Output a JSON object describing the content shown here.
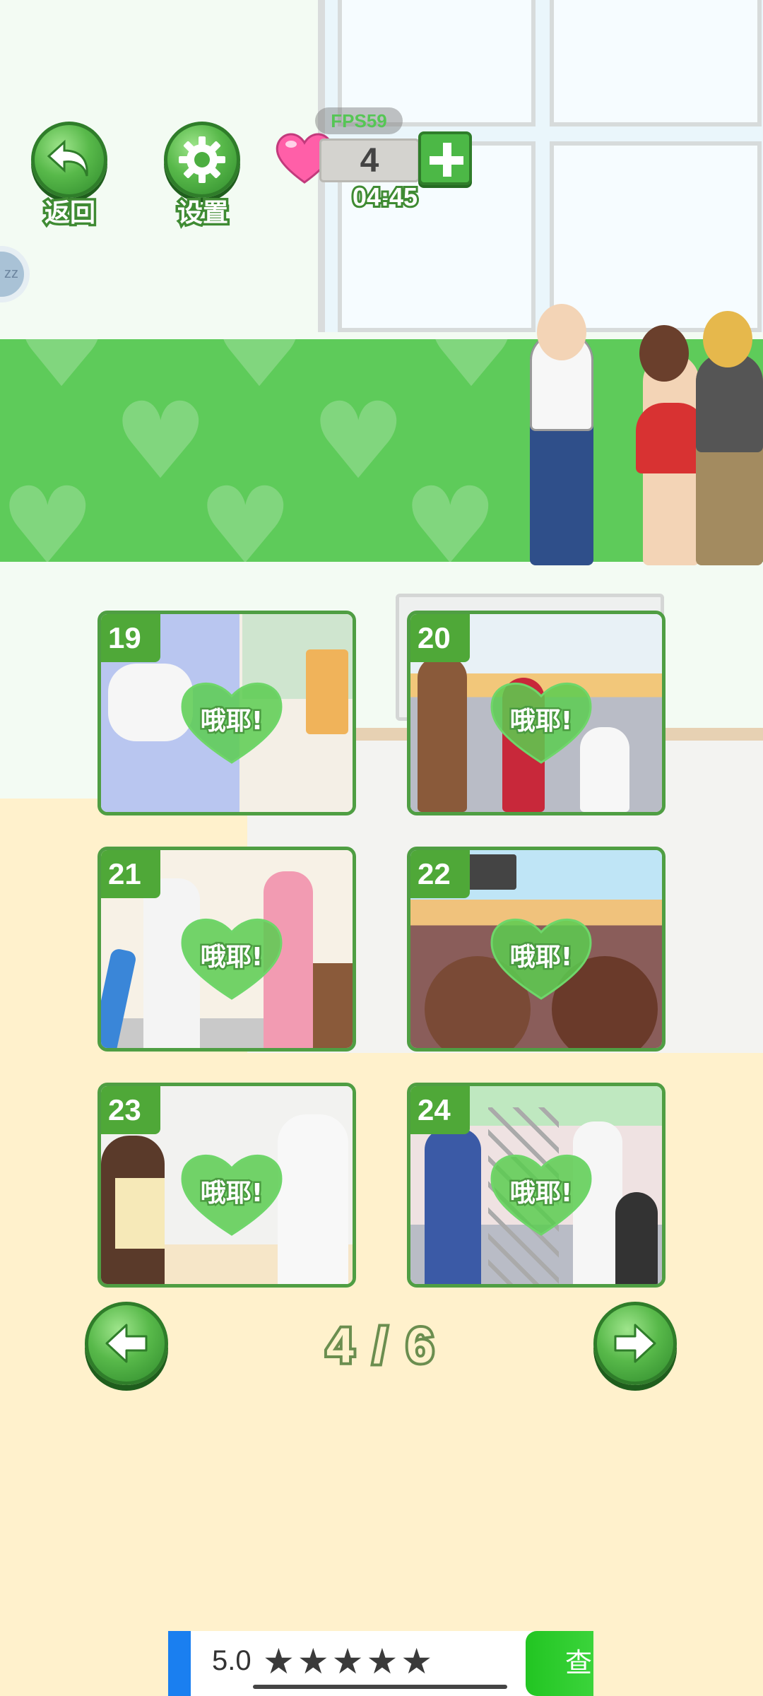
{
  "hud": {
    "back_label": "返回",
    "settings_label": "设置",
    "fps": "FPS59",
    "lives": "4",
    "timer": "04:45",
    "side_bubble": "zz"
  },
  "levels": [
    {
      "number": "19",
      "badge": "哦耶!"
    },
    {
      "number": "20",
      "badge": "哦耶!"
    },
    {
      "number": "21",
      "badge": "哦耶!"
    },
    {
      "number": "22",
      "badge": "哦耶!"
    },
    {
      "number": "23",
      "badge": "哦耶!"
    },
    {
      "number": "24",
      "badge": "哦耶!"
    }
  ],
  "pager": {
    "current": 4,
    "total": 6,
    "text": "4 / 6"
  },
  "ad": {
    "rating": "5.0",
    "stars": "★★★★★",
    "cta": "查"
  },
  "icons": {
    "back": "back-arrow-icon",
    "settings": "gear-icon",
    "lives": "heart-icon",
    "add": "plus-icon",
    "prev": "left-arrow-icon",
    "next": "right-arrow-icon",
    "badge": "green-heart-icon"
  },
  "colors": {
    "accent_green": "#4fa838",
    "heart_pink": "#ff5fa8",
    "background": "#fff1cc",
    "banner_green": "#5ecb5a"
  }
}
